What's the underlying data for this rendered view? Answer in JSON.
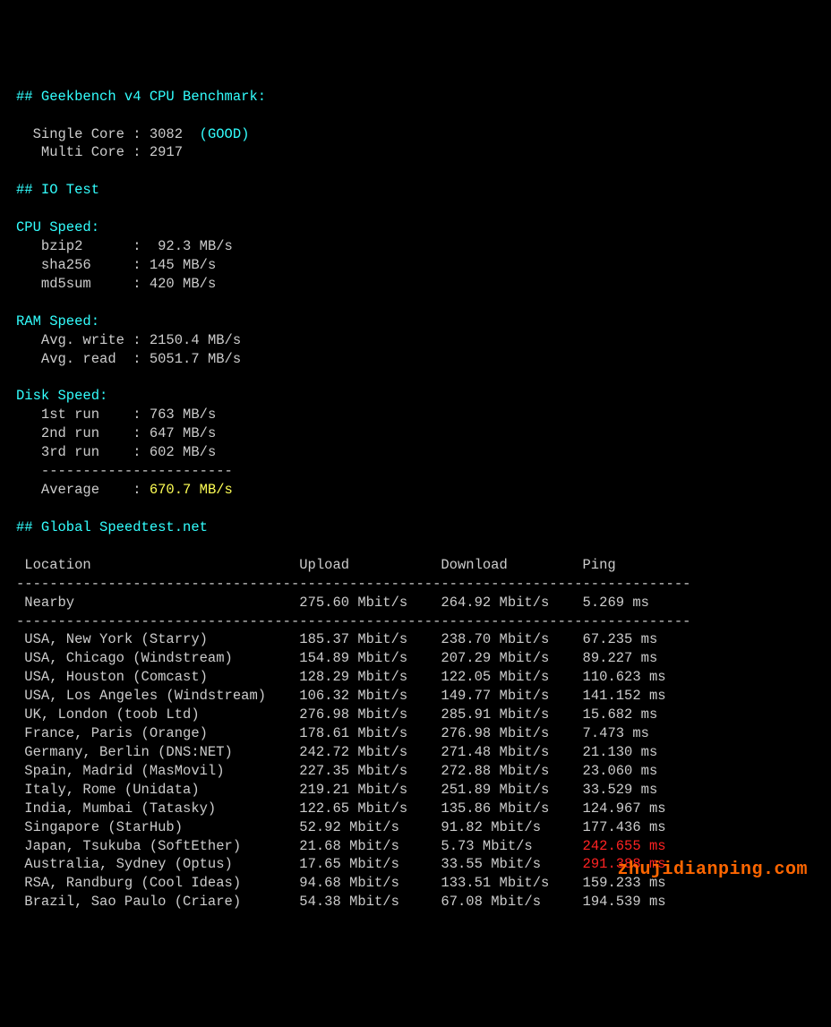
{
  "header_geekbench": "## Geekbench v4 CPU Benchmark:",
  "geekbench": {
    "single_label": "  Single Core : ",
    "single_value": "3082",
    "single_note": "  (GOOD)",
    "multi_label": "   Multi Core : ",
    "multi_value": "2917"
  },
  "header_io": "## IO Test",
  "cpu_speed_header": "CPU Speed:",
  "cpu_speed": [
    {
      "label": "   bzip2      : ",
      "value": " 92.3 MB/s"
    },
    {
      "label": "   sha256     : ",
      "value": "145 MB/s"
    },
    {
      "label": "   md5sum     : ",
      "value": "420 MB/s"
    }
  ],
  "ram_speed_header": "RAM Speed:",
  "ram_speed": [
    {
      "label": "   Avg. write : ",
      "value": "2150.4 MB/s"
    },
    {
      "label": "   Avg. read  : ",
      "value": "5051.7 MB/s"
    }
  ],
  "disk_speed_header": "Disk Speed:",
  "disk_speed": [
    {
      "label": "   1st run    : ",
      "value": "763 MB/s"
    },
    {
      "label": "   2nd run    : ",
      "value": "647 MB/s"
    },
    {
      "label": "   3rd run    : ",
      "value": "602 MB/s"
    }
  ],
  "disk_divider": "   -----------------------",
  "disk_avg_label": "   Average    : ",
  "disk_avg_value": "670.7 MB/s",
  "header_speedtest": "## Global Speedtest.net",
  "table_head": " Location                         Upload           Download         Ping",
  "dash_line": "---------------------------------------------------------------------------------",
  "nearby": {
    "loc": " Nearby                           ",
    "up": "275.60 Mbit/s    ",
    "down": "264.92 Mbit/s    ",
    "ping": "5.269 ms"
  },
  "rows": [
    {
      "loc": " USA, New York (Starry)           ",
      "up": "185.37 Mbit/s    ",
      "down": "238.70 Mbit/s    ",
      "ping": "67.235 ms"
    },
    {
      "loc": " USA, Chicago (Windstream)        ",
      "up": "154.89 Mbit/s    ",
      "down": "207.29 Mbit/s    ",
      "ping": "89.227 ms"
    },
    {
      "loc": " USA, Houston (Comcast)           ",
      "up": "128.29 Mbit/s    ",
      "down": "122.05 Mbit/s    ",
      "ping": "110.623 ms"
    },
    {
      "loc": " USA, Los Angeles (Windstream)    ",
      "up": "106.32 Mbit/s    ",
      "down": "149.77 Mbit/s    ",
      "ping": "141.152 ms"
    },
    {
      "loc": " UK, London (toob Ltd)            ",
      "up": "276.98 Mbit/s    ",
      "down": "285.91 Mbit/s    ",
      "ping": "15.682 ms"
    },
    {
      "loc": " France, Paris (Orange)           ",
      "up": "178.61 Mbit/s    ",
      "down": "276.98 Mbit/s    ",
      "ping": "7.473 ms"
    },
    {
      "loc": " Germany, Berlin (DNS:NET)        ",
      "up": "242.72 Mbit/s    ",
      "down": "271.48 Mbit/s    ",
      "ping": "21.130 ms"
    },
    {
      "loc": " Spain, Madrid (MasMovil)         ",
      "up": "227.35 Mbit/s    ",
      "down": "272.88 Mbit/s    ",
      "ping": "23.060 ms"
    },
    {
      "loc": " Italy, Rome (Unidata)            ",
      "up": "219.21 Mbit/s    ",
      "down": "251.89 Mbit/s    ",
      "ping": "33.529 ms"
    },
    {
      "loc": " India, Mumbai (Tatasky)          ",
      "up": "122.65 Mbit/s    ",
      "down": "135.86 Mbit/s    ",
      "ping": "124.967 ms"
    },
    {
      "loc": " Singapore (StarHub)              ",
      "up": "52.92 Mbit/s     ",
      "down": "91.82 Mbit/s     ",
      "ping": "177.436 ms"
    },
    {
      "loc": " Japan, Tsukuba (SoftEther)       ",
      "up": "21.68 Mbit/s     ",
      "down": "5.73 Mbit/s      ",
      "ping": "242.655 ms"
    },
    {
      "loc": " Australia, Sydney (Optus)        ",
      "up": "17.65 Mbit/s     ",
      "down": "33.55 Mbit/s     ",
      "ping": "291.388 ms"
    },
    {
      "loc": " RSA, Randburg (Cool Ideas)       ",
      "up": "94.68 Mbit/s     ",
      "down": "133.51 Mbit/s    ",
      "ping": "159.233 ms"
    },
    {
      "loc": " Brazil, Sao Paulo (Criare)       ",
      "up": "54.38 Mbit/s     ",
      "down": "67.08 Mbit/s     ",
      "ping": "194.539 ms"
    }
  ],
  "watermark": "zhujidianping.com"
}
